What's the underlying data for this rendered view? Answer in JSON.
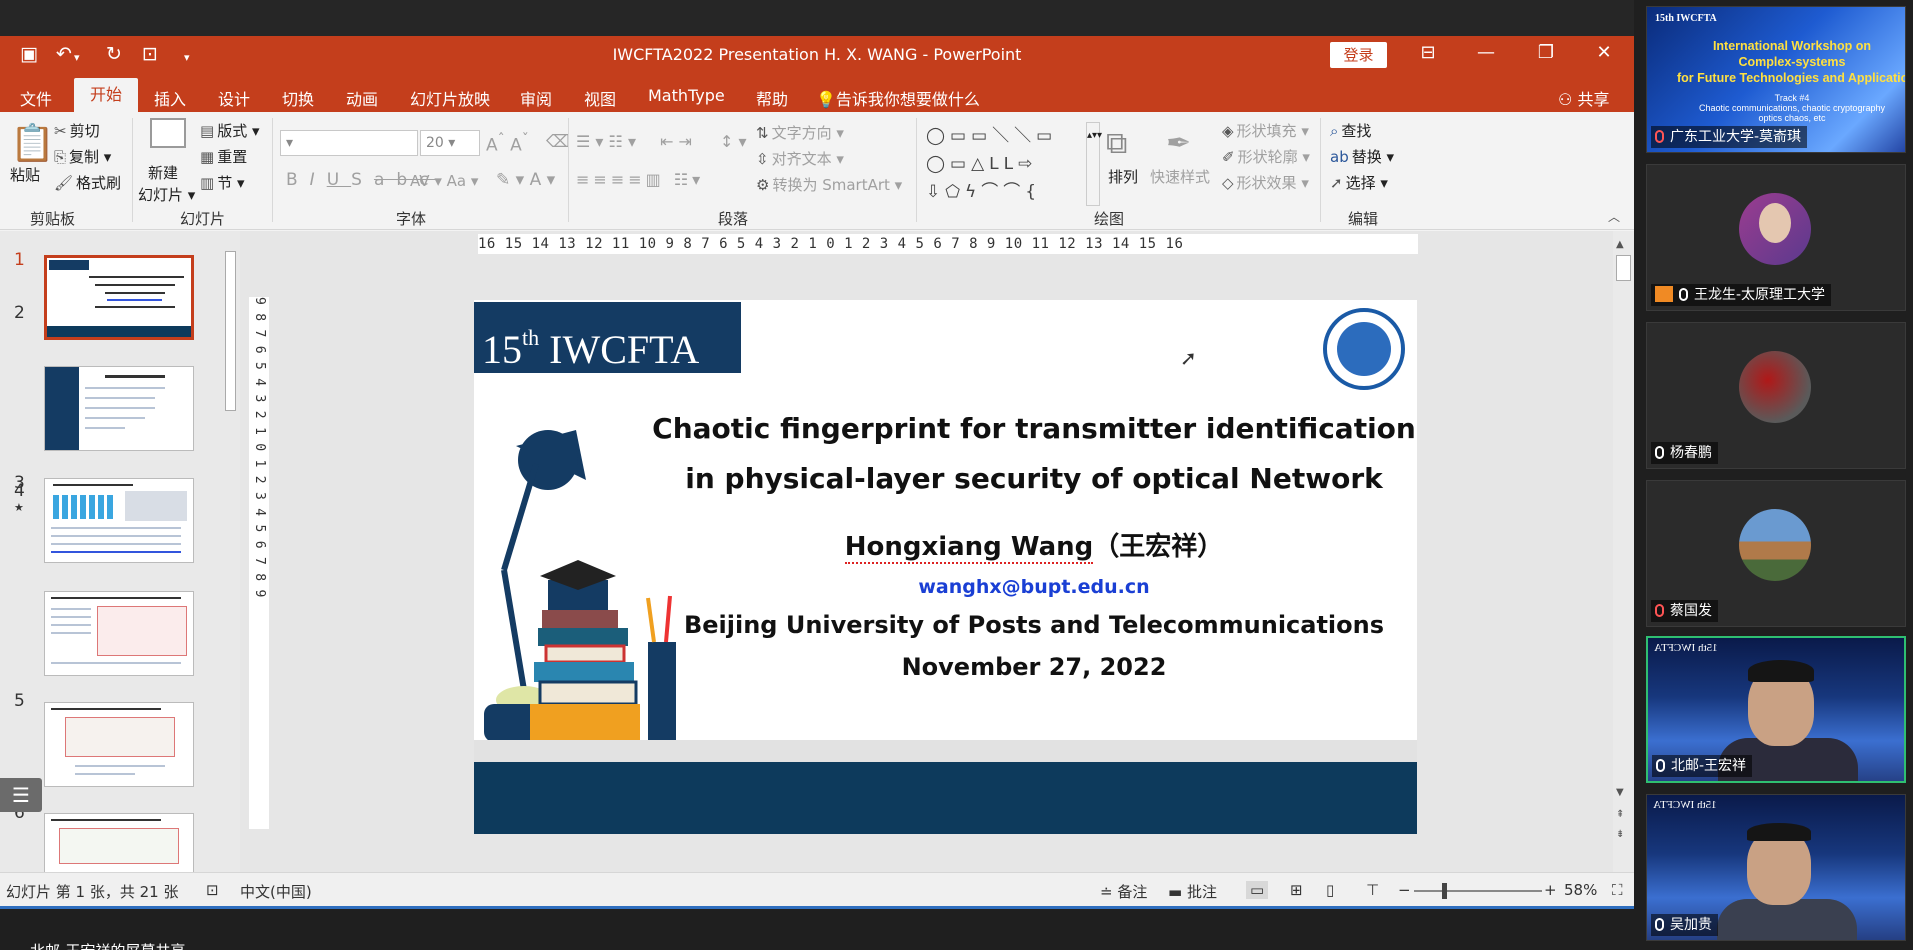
{
  "window": {
    "title": "IWCFTA2022 Presentation H. X. WANG  -  PowerPoint",
    "login_label": "登录",
    "share_label": "共享",
    "tell_me": "告诉我你想要做什么"
  },
  "menu_tabs": [
    "文件",
    "开始",
    "插入",
    "设计",
    "切换",
    "动画",
    "幻灯片放映",
    "审阅",
    "视图",
    "MathType",
    "帮助"
  ],
  "ribbon": {
    "clipboard": {
      "paste": "粘贴",
      "cut": "剪切",
      "copy": "复制",
      "format_painter": "格式刷",
      "label": "剪贴板"
    },
    "slides": {
      "new_slide_1": "新建",
      "new_slide_2": "幻灯片",
      "layout": "版式",
      "reset": "重置",
      "section": "节",
      "label": "幻灯片"
    },
    "font": {
      "font_size": "20",
      "label": "字体"
    },
    "paragraph": {
      "text_direction": "文字方向",
      "align_text": "对齐文本",
      "convert_smartart": "转换为 SmartArt",
      "label": "段落"
    },
    "drawing": {
      "arrange": "排列",
      "quick_styles": "快速样式",
      "shape_fill": "形状填充",
      "shape_outline": "形状轮廓",
      "shape_effects": "形状效果",
      "label": "绘图"
    },
    "editing": {
      "find": "查找",
      "replace": "替换",
      "select": "选择",
      "label": "编辑"
    }
  },
  "ruler": {
    "horizontal": "16 15 14 13 12 11 10  9  8  7  6  5  4  3  2  1  0  1  2  3  4  5  6  7  8  9 10 11 12 13 14 15 16",
    "vertical": "9  8  7  6  5  4  3  2  1  0  1  2  3  4  5  6  7  8  9"
  },
  "thumbnails": [
    {
      "num": "1",
      "title": "Chaotic fingerprint for transmitter identification"
    },
    {
      "num": "2",
      "title": "Outline"
    },
    {
      "num": "3",
      "title": "The security of optical networks is significant"
    },
    {
      "num": "4",
      "title": "Vulnerabilities of transparent optical networks to various physical-layer attacks"
    },
    {
      "num": "5",
      "title": "Hybrid Tx and signal authentication against injection attacks"
    },
    {
      "num": "6",
      "title": "Physical-layer identification for optical Tx"
    }
  ],
  "slide": {
    "banner_num": "15",
    "banner_sup": "th",
    "banner_rest": " IWCFTA",
    "title_line1": "Chaotic fingerprint for transmitter identification",
    "title_line2": "in physical-layer security of optical Network",
    "author_name": "Hongxiang Wang",
    "author_cn": "（王宏祥）",
    "email": "wanghx@bupt.edu.cn",
    "university": "Beijing University of Posts and Telecommunications",
    "date": "November 27, 2022"
  },
  "status": {
    "slide_info": "幻灯片 第 1 张，共 21 张",
    "language": "中文(中国)",
    "notes": "备注",
    "comments": "批注",
    "zoom": "58%"
  },
  "taskbar": {
    "label": "北邮-王宏祥的屏幕共享"
  },
  "participants": [
    {
      "name": "广东工业大学-莫嵛琪",
      "card": {
        "tag": "15th IWCFTA",
        "l1": "International Workshop on",
        "l2": "Complex-systems",
        "l3": "for Future Technologies and Applications",
        "track": "Track #4",
        "sub": "Chaotic communications, chaotic cryptography",
        "sub2": "optics chaos, etc"
      }
    },
    {
      "name": "王龙生-太原理工大学"
    },
    {
      "name": "杨春鹏"
    },
    {
      "name": "蔡国发"
    },
    {
      "name": "北邮-王宏祥",
      "bg_tag": "15th IWCFTA"
    },
    {
      "name": "吴加贵",
      "bg_tag": "15th IWCFTA"
    }
  ]
}
